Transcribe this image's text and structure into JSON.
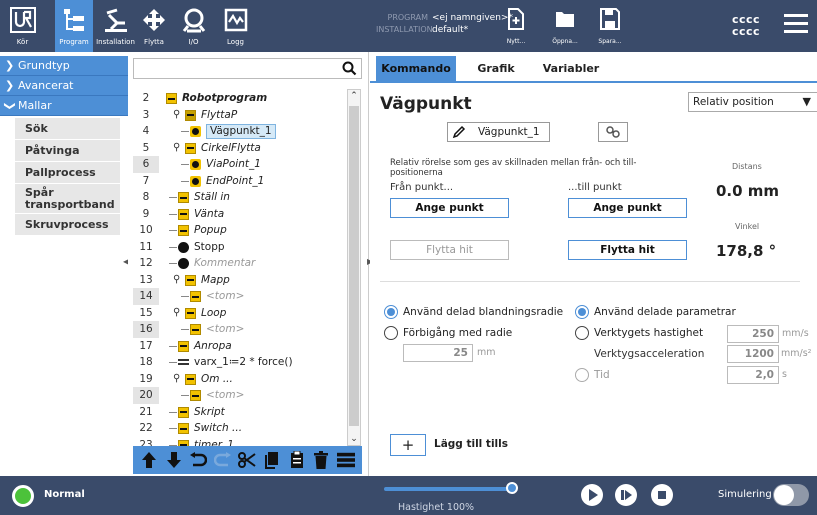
{
  "topbar": {
    "tabs": [
      {
        "label": "Kör",
        "icon": "ur-logo-icon"
      },
      {
        "label": "Program",
        "icon": "program-tree-icon"
      },
      {
        "label": "Installation",
        "icon": "installation-icon"
      },
      {
        "label": "Flytta",
        "icon": "move-arrows-icon"
      },
      {
        "label": "I/O",
        "icon": "io-icon"
      },
      {
        "label": "Logg",
        "icon": "log-icon"
      }
    ],
    "program_key": "PROGRAM",
    "program_value": "<ej namngiven>*",
    "installation_key": "INSTALLATION",
    "installation_value": "default*",
    "new_label": "Nytt...",
    "open_label": "Öppna...",
    "save_label": "Spara...",
    "user_line1": "cccc",
    "user_line2": "cccc"
  },
  "leftnav": {
    "sections": [
      "Grundtyp",
      "Avancerat",
      "Mallar"
    ],
    "items": [
      "Sök",
      "Påtvinga",
      "Pallprocess",
      "Spår transportband",
      "Skruvprocess"
    ]
  },
  "tree": {
    "search_placeholder": "",
    "rows": [
      {
        "num": "2",
        "text": "Robotprogram",
        "style": "b",
        "icon": "program-icon"
      },
      {
        "num": "3",
        "text": "FlyttaP",
        "style": "it",
        "icon": "move-icon"
      },
      {
        "num": "4",
        "text": "Vägpunkt_1",
        "style": "hl",
        "icon": "waypoint-icon"
      },
      {
        "num": "5",
        "text": "CirkelFlytta",
        "style": "it",
        "icon": "circle-move-icon"
      },
      {
        "num": "6",
        "text": "ViaPoint_1",
        "style": "it",
        "icon": "waypoint-icon"
      },
      {
        "num": "7",
        "text": "EndPoint_1",
        "style": "it",
        "icon": "waypoint-icon"
      },
      {
        "num": "8",
        "text": "Ställ in",
        "style": "it",
        "icon": "set-icon"
      },
      {
        "num": "9",
        "text": "Vänta",
        "style": "it",
        "icon": "wait-icon"
      },
      {
        "num": "10",
        "text": "Popup",
        "style": "it",
        "icon": "popup-icon"
      },
      {
        "num": "11",
        "text": "Stopp",
        "style": "n",
        "icon": "stop-icon"
      },
      {
        "num": "12",
        "text": "Kommentar",
        "style": "dim",
        "icon": "comment-icon"
      },
      {
        "num": "13",
        "text": "Mapp",
        "style": "it",
        "icon": "folder-icon"
      },
      {
        "num": "14",
        "text": "<tom>",
        "style": "dim",
        "icon": "empty-icon"
      },
      {
        "num": "15",
        "text": "Loop",
        "style": "it",
        "icon": "loop-icon"
      },
      {
        "num": "16",
        "text": "<tom>",
        "style": "dim",
        "icon": "empty-icon"
      },
      {
        "num": "17",
        "text": "Anropa",
        "style": "it",
        "icon": "call-icon"
      },
      {
        "num": "18",
        "text": "varx_1≔2 * force()",
        "style": "n",
        "icon": "assignment-icon"
      },
      {
        "num": "19",
        "text": "Om ...",
        "style": "it",
        "icon": "if-icon"
      },
      {
        "num": "20",
        "text": "<tom>",
        "style": "dim",
        "icon": "empty-icon"
      },
      {
        "num": "21",
        "text": "Skript",
        "style": "it",
        "icon": "script-icon"
      },
      {
        "num": "22",
        "text": "Switch ...",
        "style": "it",
        "icon": "switch-icon"
      },
      {
        "num": "23",
        "text": "timer_1",
        "style": "it",
        "icon": "timer-icon"
      }
    ]
  },
  "panel": {
    "tabs": [
      "Kommando",
      "Grafik",
      "Variabler"
    ],
    "title": "Vägpunkt",
    "position_mode": "Relativ position",
    "waypoint_name": "Vägpunkt_1",
    "description": "Relativ rörelse som ges av skillnaden mellan från- och till-positionerna",
    "from_label": "Från punkt...",
    "to_label": "...till punkt",
    "set_point": "Ange punkt",
    "move_here": "Flytta hit",
    "distance_label": "Distans",
    "distance_value": "0.0 mm",
    "angle_label": "Vinkel",
    "angle_value": "178,8 °",
    "blend_shared": "Använd delad blandningsradie",
    "blend_radius": "Förbigång med radie",
    "blend_value": "25",
    "blend_unit": "mm",
    "param_shared": "Använd delade parametrar",
    "tool_speed": "Verktygets hastighet",
    "tool_speed_value": "250",
    "tool_speed_unit": "mm/s",
    "tool_accel": "Verktygsacceleration",
    "tool_accel_value": "1200",
    "tool_accel_unit": "mm/s²",
    "time": "Tid",
    "time_value": "2,0",
    "time_unit": "s",
    "add_until_label": "Lägg till tills"
  },
  "bottombar": {
    "status": "Normal",
    "speed_label": "Hastighet 100%",
    "speed_fraction": 1.0,
    "simulation_label": "Simulering",
    "colors": {
      "status": "#4cc23a",
      "accent": "#4d8fd6",
      "bar": "#3a4b6a"
    }
  }
}
